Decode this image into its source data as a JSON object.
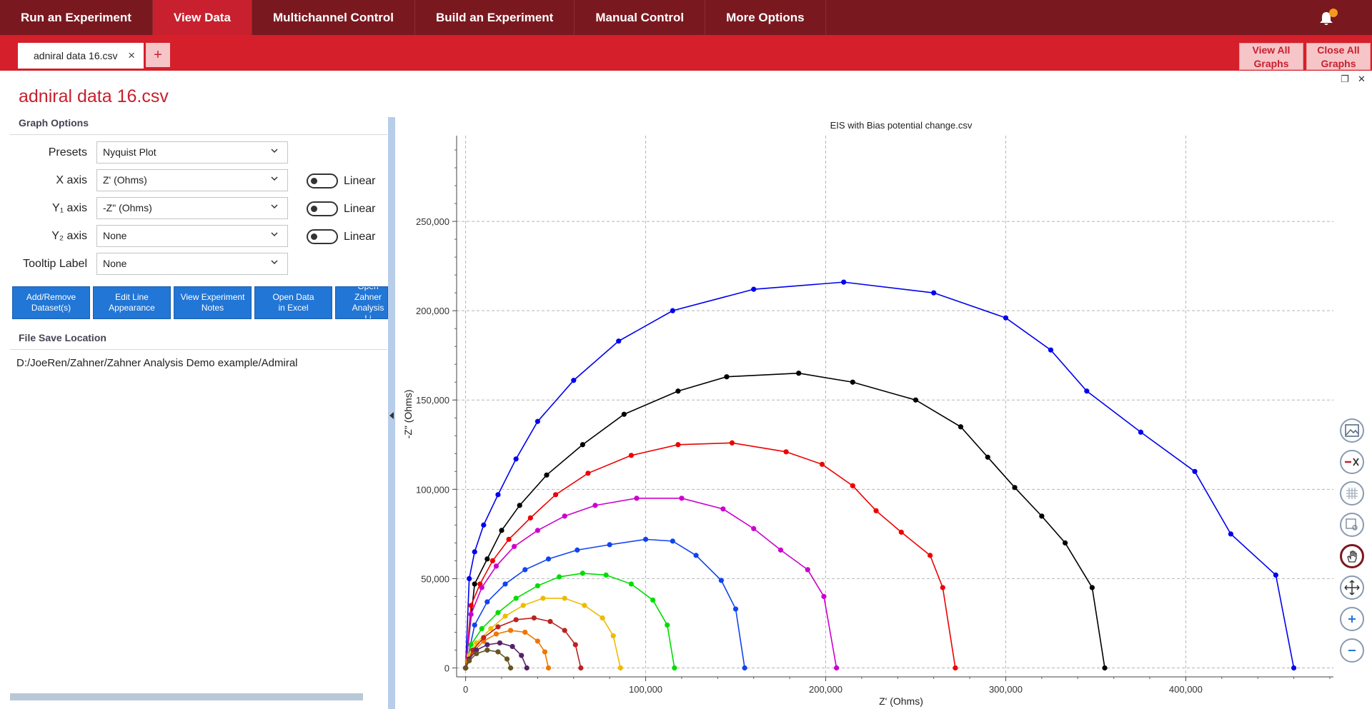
{
  "nav": {
    "items": [
      {
        "label": "Run an Experiment"
      },
      {
        "label": "View Data",
        "active": true
      },
      {
        "label": "Multichannel Control"
      },
      {
        "label": "Build an Experiment"
      },
      {
        "label": "Manual Control"
      },
      {
        "label": "More Options"
      }
    ],
    "bell_icon": "bell-icon"
  },
  "tabs": {
    "open_tab": "adniral data 16.csv",
    "close_glyph": "×",
    "add_glyph": "+",
    "view_all": "View All Graphs",
    "close_all": "Close All Graphs"
  },
  "window": {
    "restore_glyph": "❐",
    "close_glyph": "✕"
  },
  "document": {
    "title": "adniral data 16.csv"
  },
  "graph_options": {
    "heading": "Graph Options",
    "presets": {
      "label": "Presets",
      "value": "Nyquist Plot"
    },
    "x_axis": {
      "label": "X axis",
      "value": "Z' (Ohms)",
      "scale": "Linear"
    },
    "y1_axis": {
      "label": "Y₁ axis",
      "value": "-Z\" (Ohms)",
      "scale": "Linear"
    },
    "y2_axis": {
      "label": "Y₂ axis",
      "value": "None",
      "scale": "Linear"
    },
    "tooltip": {
      "label": "Tooltip Label",
      "value": "None"
    }
  },
  "actions": [
    {
      "label": "Add/Remove\nDataset(s)"
    },
    {
      "label": "Edit Line\nAppearance"
    },
    {
      "label": "View Experiment\nNotes"
    },
    {
      "label": "Open Data\nin Excel"
    },
    {
      "label": "Open Zahner\nAnalysis Li"
    }
  ],
  "file_save": {
    "heading": "File Save Location",
    "path": "D:/JoeRen/Zahner/Zahner Analysis Demo example/Admiral"
  },
  "toolbar_icons": [
    "image-icon",
    "remove-x-icon",
    "grid-icon",
    "zoom-box-icon",
    "pan-hand-icon",
    "move-arrows-icon",
    "zoom-in-icon",
    "zoom-out-icon"
  ],
  "chart_data": {
    "type": "scatter",
    "title": "EIS with Bias potential change.csv",
    "xlabel": "Z' (Ohms)",
    "ylabel": "-Z\" (Ohms)",
    "xlim": [
      -5000,
      482000
    ],
    "ylim": [
      -5000,
      298000
    ],
    "x_ticks": [
      "0",
      "100,000",
      "200,000",
      "300,000",
      "400,000"
    ],
    "y_ticks": [
      "0",
      "50,000",
      "100,000",
      "150,000",
      "200,000",
      "250,000"
    ],
    "grid": true,
    "series": [
      {
        "color": "#0000ee",
        "values": [
          [
            460000,
            0
          ],
          [
            450000,
            52000
          ],
          [
            425000,
            75000
          ],
          [
            405000,
            110000
          ],
          [
            375000,
            132000
          ],
          [
            345000,
            155000
          ],
          [
            325000,
            178000
          ],
          [
            300000,
            196000
          ],
          [
            260000,
            210000
          ],
          [
            210000,
            216000
          ],
          [
            160000,
            212000
          ],
          [
            115000,
            200000
          ],
          [
            85000,
            183000
          ],
          [
            60000,
            161000
          ],
          [
            40000,
            138000
          ],
          [
            28000,
            117000
          ],
          [
            18000,
            97000
          ],
          [
            10000,
            80000
          ],
          [
            5000,
            65000
          ],
          [
            2000,
            50000
          ],
          [
            0,
            0
          ]
        ]
      },
      {
        "color": "#000000",
        "values": [
          [
            355000,
            0
          ],
          [
            348000,
            45000
          ],
          [
            333000,
            70000
          ],
          [
            320000,
            85000
          ],
          [
            305000,
            101000
          ],
          [
            290000,
            118000
          ],
          [
            275000,
            135000
          ],
          [
            250000,
            150000
          ],
          [
            215000,
            160000
          ],
          [
            185000,
            165000
          ],
          [
            145000,
            163000
          ],
          [
            118000,
            155000
          ],
          [
            88000,
            142000
          ],
          [
            65000,
            125000
          ],
          [
            45000,
            108000
          ],
          [
            30000,
            91000
          ],
          [
            20000,
            77000
          ],
          [
            12000,
            61000
          ],
          [
            5000,
            47000
          ],
          [
            0,
            0
          ]
        ]
      },
      {
        "color": "#ee0000",
        "values": [
          [
            272000,
            0
          ],
          [
            265000,
            45000
          ],
          [
            258000,
            63000
          ],
          [
            242000,
            76000
          ],
          [
            228000,
            88000
          ],
          [
            215000,
            102000
          ],
          [
            198000,
            114000
          ],
          [
            178000,
            121000
          ],
          [
            148000,
            126000
          ],
          [
            118000,
            125000
          ],
          [
            92000,
            119000
          ],
          [
            68000,
            109000
          ],
          [
            50000,
            97000
          ],
          [
            36000,
            84000
          ],
          [
            24000,
            72000
          ],
          [
            15000,
            60000
          ],
          [
            8000,
            47000
          ],
          [
            3000,
            35000
          ],
          [
            0,
            0
          ]
        ]
      },
      {
        "color": "#cc00cc",
        "values": [
          [
            206000,
            0
          ],
          [
            199000,
            40000
          ],
          [
            190000,
            55000
          ],
          [
            175000,
            66000
          ],
          [
            160000,
            78000
          ],
          [
            143000,
            89000
          ],
          [
            120000,
            95000
          ],
          [
            95000,
            95000
          ],
          [
            72000,
            91000
          ],
          [
            55000,
            85000
          ],
          [
            40000,
            77000
          ],
          [
            27000,
            68000
          ],
          [
            17000,
            57000
          ],
          [
            9000,
            45000
          ],
          [
            3000,
            30000
          ],
          [
            0,
            0
          ]
        ]
      },
      {
        "color": "#1144ee",
        "values": [
          [
            155000,
            0
          ],
          [
            150000,
            33000
          ],
          [
            142000,
            49000
          ],
          [
            128000,
            63000
          ],
          [
            115000,
            71000
          ],
          [
            100000,
            72000
          ],
          [
            80000,
            69000
          ],
          [
            62000,
            66000
          ],
          [
            46000,
            61000
          ],
          [
            33000,
            55000
          ],
          [
            22000,
            47000
          ],
          [
            12000,
            37000
          ],
          [
            5000,
            24000
          ],
          [
            0,
            0
          ]
        ]
      },
      {
        "color": "#00dd00",
        "values": [
          [
            116000,
            0
          ],
          [
            112000,
            24000
          ],
          [
            104000,
            38000
          ],
          [
            92000,
            47000
          ],
          [
            78000,
            52000
          ],
          [
            65000,
            53000
          ],
          [
            52000,
            51000
          ],
          [
            40000,
            46000
          ],
          [
            28000,
            39000
          ],
          [
            18000,
            31000
          ],
          [
            9000,
            22000
          ],
          [
            3000,
            13000
          ],
          [
            0,
            0
          ]
        ]
      },
      {
        "color": "#eebb00",
        "values": [
          [
            86000,
            0
          ],
          [
            82000,
            18000
          ],
          [
            76000,
            28000
          ],
          [
            66000,
            35000
          ],
          [
            55000,
            39000
          ],
          [
            43000,
            39000
          ],
          [
            32000,
            35000
          ],
          [
            22000,
            29000
          ],
          [
            14000,
            22000
          ],
          [
            6000,
            14000
          ],
          [
            2000,
            7000
          ],
          [
            0,
            0
          ]
        ]
      },
      {
        "color": "#ee7700",
        "values": [
          [
            46000,
            0
          ],
          [
            44000,
            9000
          ],
          [
            40000,
            15000
          ],
          [
            33000,
            20000
          ],
          [
            25000,
            21000
          ],
          [
            17000,
            19000
          ],
          [
            10000,
            15000
          ],
          [
            5000,
            10000
          ],
          [
            1000,
            4000
          ],
          [
            0,
            0
          ]
        ]
      },
      {
        "color": "#bb2222",
        "values": [
          [
            64000,
            0
          ],
          [
            61000,
            13000
          ],
          [
            55000,
            21000
          ],
          [
            47000,
            26000
          ],
          [
            38000,
            28000
          ],
          [
            28000,
            27000
          ],
          [
            18000,
            23000
          ],
          [
            10000,
            17000
          ],
          [
            4000,
            10000
          ],
          [
            0,
            0
          ]
        ]
      },
      {
        "color": "#552266",
        "values": [
          [
            34000,
            0
          ],
          [
            31000,
            7000
          ],
          [
            26000,
            12000
          ],
          [
            19000,
            14000
          ],
          [
            12000,
            13000
          ],
          [
            6000,
            10000
          ],
          [
            2000,
            5000
          ],
          [
            0,
            0
          ]
        ]
      },
      {
        "color": "#665522",
        "values": [
          [
            25000,
            0
          ],
          [
            23000,
            5000
          ],
          [
            18000,
            9000
          ],
          [
            12000,
            10000
          ],
          [
            6000,
            8000
          ],
          [
            2000,
            4000
          ],
          [
            0,
            0
          ]
        ]
      }
    ]
  }
}
